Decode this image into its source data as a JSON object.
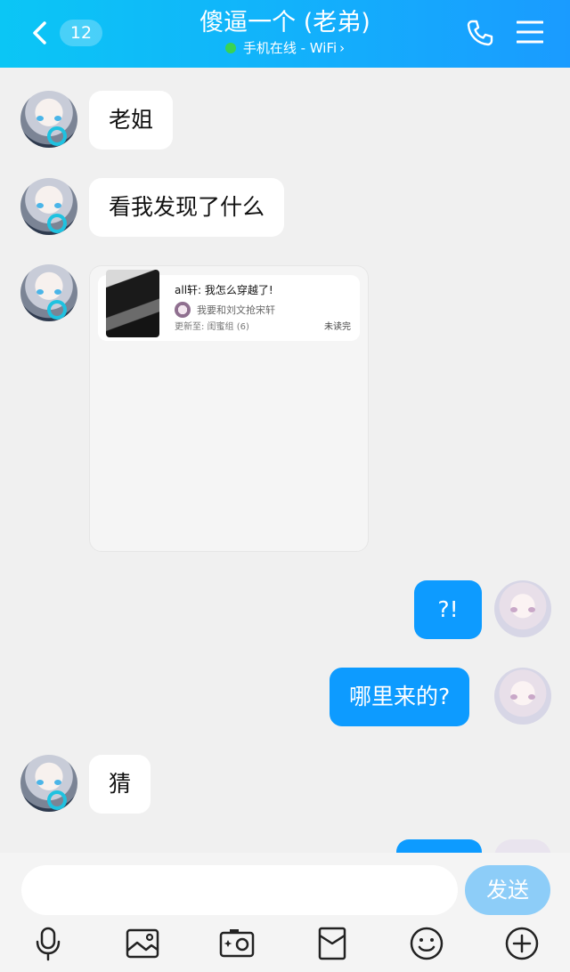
{
  "header": {
    "unread_count": "12",
    "title": "傻逼一个 (老弟)",
    "status": "手机在线 - WiFi",
    "status_arrow": "›"
  },
  "messages": [
    {
      "side": "in",
      "text": "老姐"
    },
    {
      "side": "in",
      "text": "看我发现了什么"
    },
    {
      "side": "in",
      "type": "card"
    },
    {
      "side": "out",
      "text": "?!"
    },
    {
      "side": "out",
      "text": "哪里来的?"
    },
    {
      "side": "in",
      "text": "猜"
    }
  ],
  "card": {
    "title": "all轩: 我怎么穿越了!",
    "author": "我要和刘文抢宋轩",
    "update": "更新至: 闺蜜组 (6)",
    "status": "未读完"
  },
  "input": {
    "placeholder": "",
    "send_label": "发送"
  },
  "toolbar": [
    "mic-icon",
    "image-icon",
    "camera-icon",
    "red-packet-icon",
    "emoji-icon",
    "plus-icon"
  ],
  "colors": {
    "header_start": "#0bc6f5",
    "header_end": "#1a9bff",
    "outgoing_bubble": "#0d9bff",
    "send_button": "#8dcdf8",
    "online_dot": "#39d353"
  }
}
